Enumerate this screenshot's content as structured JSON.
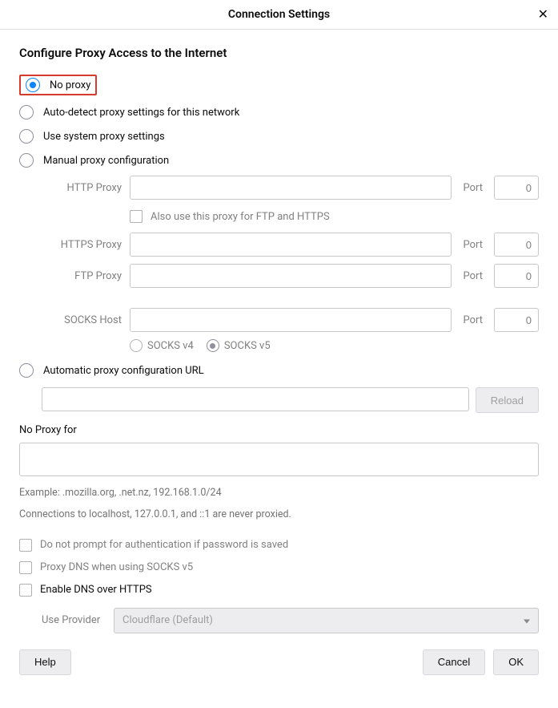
{
  "dialog": {
    "title": "Connection Settings",
    "close": "✕"
  },
  "heading": "Configure Proxy Access to the Internet",
  "radios": {
    "no_proxy": "No proxy",
    "auto_detect": "Auto-detect proxy settings for this network",
    "system": "Use system proxy settings",
    "manual": "Manual proxy configuration",
    "auto_url": "Automatic proxy configuration URL"
  },
  "fields": {
    "http_label": "HTTP Proxy",
    "https_label": "HTTPS Proxy",
    "ftp_label": "FTP Proxy",
    "socks_label": "SOCKS Host",
    "port_label": "Port",
    "port_value": "0",
    "also_use": "Also use this proxy for FTP and HTTPS",
    "socks_v4": "SOCKS v4",
    "socks_v5": "SOCKS v5"
  },
  "reload": "Reload",
  "no_proxy_for": {
    "label": "No Proxy for",
    "example": "Example: .mozilla.org, .net.nz, 192.168.1.0/24",
    "note": "Connections to localhost, 127.0.0.1, and ::1 are never proxied."
  },
  "options": {
    "no_prompt": "Do not prompt for authentication if password is saved",
    "proxy_dns": "Proxy DNS when using SOCKS v5",
    "enable_doh": "Enable DNS over HTTPS",
    "use_provider": "Use Provider",
    "provider_value": "Cloudflare (Default)"
  },
  "footer": {
    "help": "Help",
    "cancel": "Cancel",
    "ok": "OK"
  }
}
